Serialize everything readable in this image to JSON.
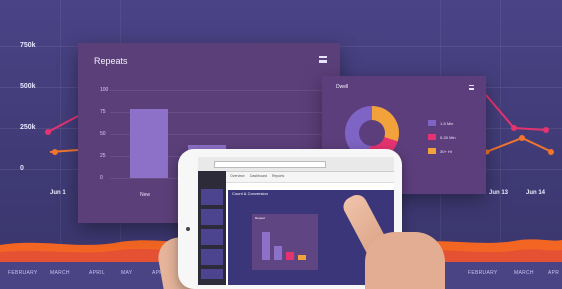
{
  "background_chart": {
    "y_ticks": [
      "750k",
      "500k",
      "250k",
      "0"
    ],
    "x_ticks_left": [
      "Jun 1"
    ],
    "x_ticks_right": [
      "Jun 13",
      "Jun 14"
    ],
    "months": [
      "FEBRUARY",
      "MARCH",
      "APRIL",
      "MAY",
      "APR",
      "FEBRUARY",
      "MARCH",
      "APR"
    ]
  },
  "repeats_card": {
    "title": "Repeats",
    "menu_icon": "hamburger-menu-icon",
    "y_ticks": [
      "100",
      "75",
      "50",
      "25",
      "0"
    ],
    "bar_labels": [
      "New"
    ],
    "chart_data": {
      "type": "bar",
      "categories": [
        "New",
        ""
      ],
      "values": [
        78,
        38
      ],
      "ylim": [
        0,
        100
      ]
    }
  },
  "dwell_card": {
    "title": "Dwell",
    "legend": [
      {
        "label": "1-5 Min",
        "color": "#7e64c4"
      },
      {
        "label": "5-30 Min",
        "color": "#e5336f"
      },
      {
        "label": "30+ Hr",
        "color": "#f2a23b"
      }
    ]
  },
  "tablet": {
    "browser_tabs": [
      "Overview",
      "Dashboard",
      "Reports"
    ],
    "main_title": "Count & Conversion",
    "mini_card_title": "Repeat"
  },
  "colors": {
    "background": "#433c78",
    "card": "#5b3f79",
    "accent_orange": "#f2a23b",
    "accent_pink": "#e5336f",
    "accent_purple": "#8d70c7"
  }
}
